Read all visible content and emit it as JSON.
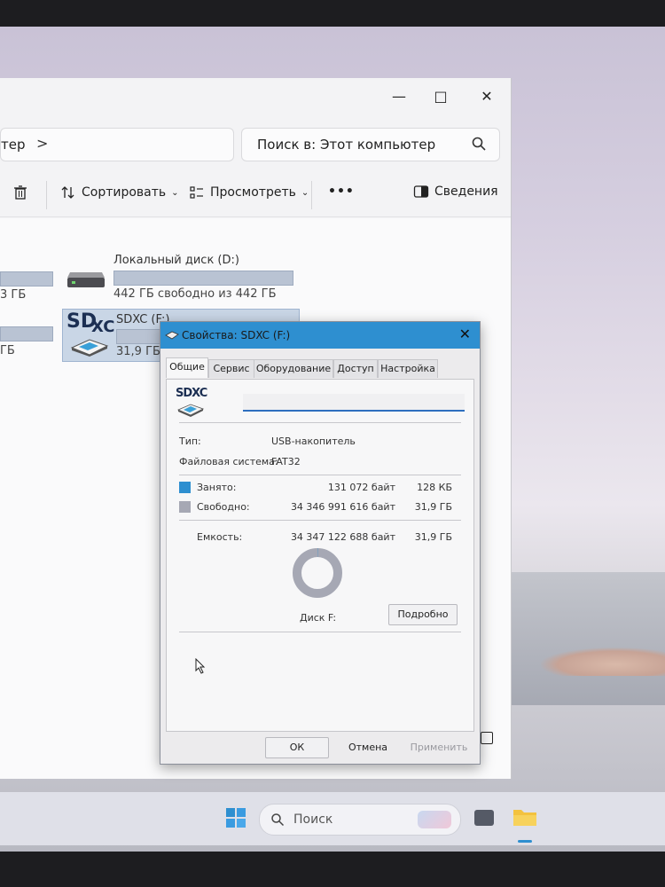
{
  "explorer": {
    "address_text": "тер",
    "address_chevron": ">",
    "search_placeholder": "Поиск в: Этот компьютер",
    "toolbar": {
      "sort_label": "Сортировать",
      "view_label": "Просмотреть",
      "more_label": "•••",
      "details_label": "Сведения"
    },
    "drives": [
      {
        "name": "",
        "info": "3 ГБ"
      },
      {
        "name": "",
        "info": "ГБ"
      },
      {
        "name": "Локальный диск (D:)",
        "info": "442 ГБ свободно из 442 ГБ",
        "used_fraction": 0.0
      },
      {
        "name": "SDXC (F:)",
        "info": "31,9 ГБ свободно из 31,9 ГБ",
        "used_fraction": 0.0
      }
    ]
  },
  "dialog": {
    "title": "Свойства: SDXC (F:)",
    "tabs": [
      "Общие",
      "Сервис",
      "Оборудование",
      "Доступ",
      "Настройка"
    ],
    "icon_text": "SDXC",
    "name_value": "",
    "type_label": "Тип:",
    "type_value": "USB-накопитель",
    "fs_label": "Файловая система:",
    "fs_value": "FAT32",
    "used_label": "Занято:",
    "used_bytes": "131 072 байт",
    "used_short": "128 КБ",
    "free_label": "Свободно:",
    "free_bytes": "34 346 991 616 байт",
    "free_short": "31,9 ГБ",
    "capacity_label": "Емкость:",
    "capacity_bytes": "34 347 122 688 байт",
    "capacity_short": "31,9 ГБ",
    "disk_label": "Диск F:",
    "details_button": "Подробно",
    "ok_button": "ОК",
    "cancel_button": "Отмена",
    "apply_button": "Применить",
    "used_fraction": 3.8e-06,
    "colors": {
      "used": "#2e8fd0",
      "free": "#a6a8b4"
    }
  },
  "taskbar": {
    "search_placeholder": "Поиск"
  }
}
